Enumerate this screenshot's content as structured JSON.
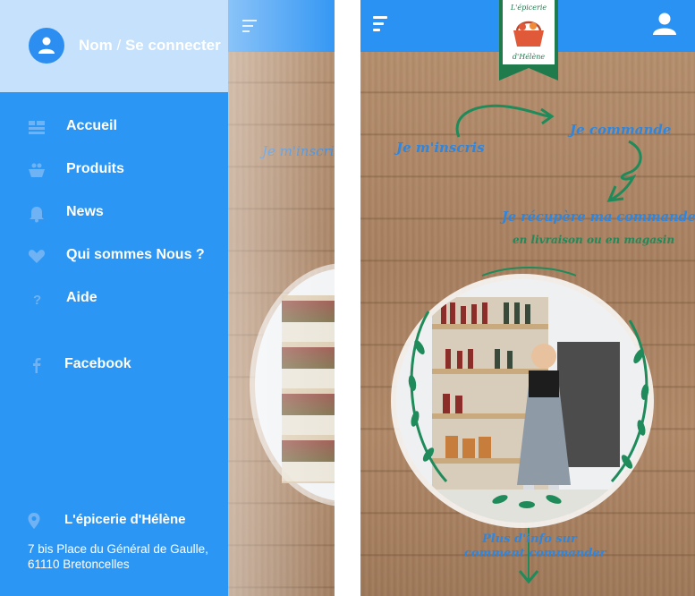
{
  "drawer": {
    "login_name": "Nom",
    "login_sep": " / ",
    "login_action": "Se connecter",
    "items": [
      {
        "label": "Accueil",
        "icon": "dashboard-icon"
      },
      {
        "label": "Produits",
        "icon": "basket-icon"
      },
      {
        "label": "News",
        "icon": "bell-icon"
      },
      {
        "label": "Qui sommes Nous ?",
        "icon": "heart-hands-icon"
      },
      {
        "label": "Aide",
        "icon": "question-icon"
      }
    ],
    "social": {
      "label": "Facebook",
      "icon": "facebook-icon"
    },
    "store": {
      "name": "L'épicerie d'Hélène",
      "address_line1": "7 bis Place du Général de Gaulle,",
      "address_line2": "61110 Bretoncelles"
    }
  },
  "home": {
    "logo_text_top": "L'épicerie",
    "logo_text_bottom": "d'Hélène",
    "step1": "Je m'inscris",
    "step2": "Je commande",
    "step3": "Je récupère ma commande",
    "step3_sub": "en livraison ou en magasin",
    "info_line1": "Plus d'info sur",
    "info_line2": "comment commander"
  },
  "colors": {
    "primary": "#2a92f3",
    "header_light": "#c6e1fb",
    "hand_blue": "#2d86e0",
    "hand_green": "#1f8a5a"
  }
}
